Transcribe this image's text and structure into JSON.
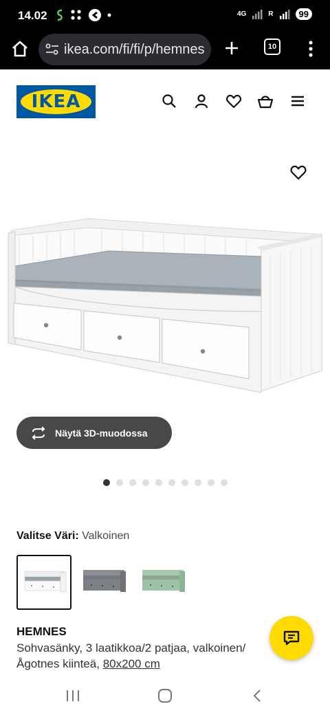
{
  "status": {
    "time": "14.02",
    "net_top": "4G",
    "net_r": "R",
    "battery": "99"
  },
  "browser": {
    "url": "ikea.com/fi/fi/p/hemnes",
    "tab_count": "10"
  },
  "header": {
    "logo_text": "IKEA"
  },
  "gallery": {
    "view_3d_label": "Näytä 3D-muodossa",
    "image_count": 10,
    "active_index": 0
  },
  "color_select": {
    "label": "Valitse Väri:",
    "value": "Valkoinen",
    "swatches": [
      "white",
      "grey",
      "green"
    ]
  },
  "product": {
    "name": "HEMNES",
    "description": "Sohvasänky, 3 laatikkoa/2 patjaa, valkoinen/",
    "variant_prefix": "Ågotnes kiinteä,",
    "size": "80x200 cm"
  },
  "colors": {
    "ikea_blue": "#0058a3",
    "ikea_yellow": "#ffdb00",
    "mattress": "#a7b0b8",
    "button_dark": "#484848"
  }
}
